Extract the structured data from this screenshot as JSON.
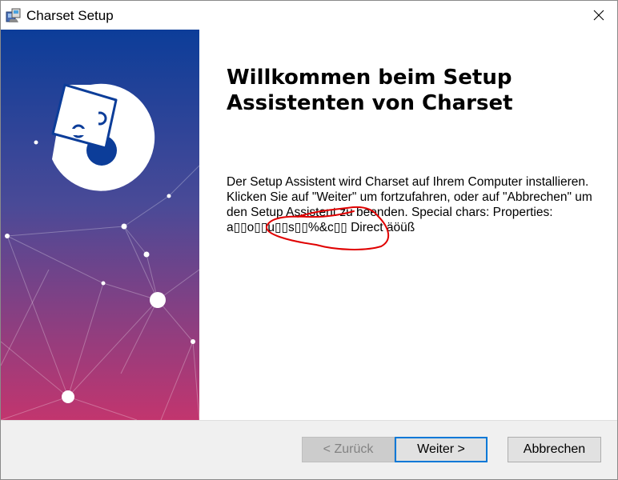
{
  "window": {
    "title": "Charset Setup",
    "icons": {
      "app": "installer-app-icon",
      "close": "close-icon"
    }
  },
  "banner": {
    "logo": "puzzle-logo-icon",
    "colors": {
      "top": "#0c3d99",
      "bottom": "#c2356e"
    }
  },
  "content": {
    "title": "Willkommen beim Setup Assistenten von Charset",
    "body": "Der Setup Assistent wird Charset auf Ihrem Computer installieren. Klicken Sie auf \"Weiter\" um fortzufahren, oder auf \"Abbrechen\" um den Setup Assistent zu beenden. Special chars: Properties: a▯▯o▯▯u▯▯s▯▯%&c▯▯ Direct äöüß"
  },
  "annotation": {
    "color": "#e00000"
  },
  "buttons": {
    "back": "< Zurück",
    "next": "Weiter >",
    "cancel": "Abbrechen"
  },
  "colors": {
    "accent": "#0078d7"
  }
}
